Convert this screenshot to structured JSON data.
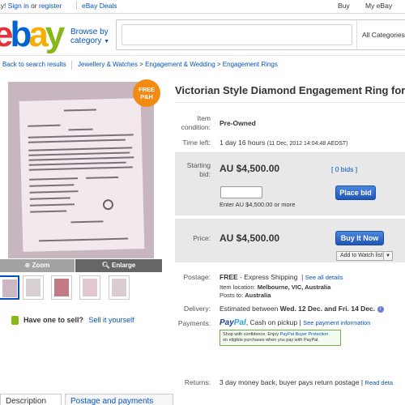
{
  "topbar": {
    "greeting_prefix": "ay! ",
    "sign_in": "Sign in",
    "or": " or ",
    "register": "register",
    "deals": "eBay Deals",
    "buy": "Buy",
    "my_ebay": "My eBay"
  },
  "header": {
    "logo": {
      "e": "e",
      "b": "b",
      "a": "a",
      "y": "y"
    },
    "browse_line1": "Browse by",
    "browse_line2": "category",
    "search_placeholder": "",
    "category_select": "All Categories"
  },
  "breadcrumb": {
    "back": "Back to search results",
    "items": [
      "Jewellery & Watches",
      "Engagement & Wedding",
      "Engagement Rings"
    ],
    "separator": " > "
  },
  "gallery": {
    "badge_line1": "FREE",
    "badge_line2": "P&H",
    "zoom": "Zoom",
    "enlarge": "Enlarge"
  },
  "sell": {
    "question": "Have one to sell?",
    "link": "Sell it yourself"
  },
  "tabs": [
    "Description",
    "Postage and payments"
  ],
  "listing": {
    "title": "Victorian Style Diamond Engagement Ring for Sa",
    "condition_label_1": "Item",
    "condition_label_2": "condition:",
    "condition": "Pre-Owned",
    "time_left_label": "Time left:",
    "time_left": "1 day 16 hours",
    "time_left_end": "(11 Dec, 2012 14:04:48 AEDST)",
    "starting_bid_label_1": "Starting",
    "starting_bid_label_2": "bid:",
    "starting_bid": "AU $4,500.00",
    "bids": "[ 0 bids ]",
    "bid_input_placeholder": "",
    "bid_hint": "Enter AU $4,500.00 or more",
    "place_bid": "Place bid",
    "price_label": "Price:",
    "price": "AU $4,500.00",
    "buy_it_now": "Buy It Now",
    "watch_list": "Add to Watch list",
    "postage_label": "Postage:",
    "postage_free": "FREE",
    "postage_method": " - Express Shipping",
    "see_details": "See all details",
    "item_location_label": "Item location: ",
    "item_location": "Melbourne, VIC, Australia",
    "posts_to_label": "Posts to: ",
    "posts_to": "Australia",
    "delivery_label": "Delivery:",
    "delivery_prefix": "Estimated between ",
    "delivery_range": "Wed. 12 Dec. and Fri. 14 Dec.",
    "payments_label": "Payments:",
    "paypal_pay": "Pay",
    "paypal_pal": "Pal",
    "payments_text": ", Cash on pickup",
    "payment_info": "See payment information",
    "paypal_note_1": "Shop with confidence. Enjoy ",
    "paypal_note_link": "PayPal Buyer Protection",
    "paypal_note_2": "on eligible purchases when you pay with PayPal.",
    "returns_label": "Returns:",
    "returns": "3 day money back, buyer pays return postage",
    "read_details": "Read deta"
  },
  "colors": {
    "link": "#0654ba",
    "badge": "#f28a13",
    "button": "#1f56b8",
    "logo_e": "#e53238",
    "logo_b": "#0064d2",
    "logo_a": "#f5af02",
    "logo_y": "#86b817"
  }
}
